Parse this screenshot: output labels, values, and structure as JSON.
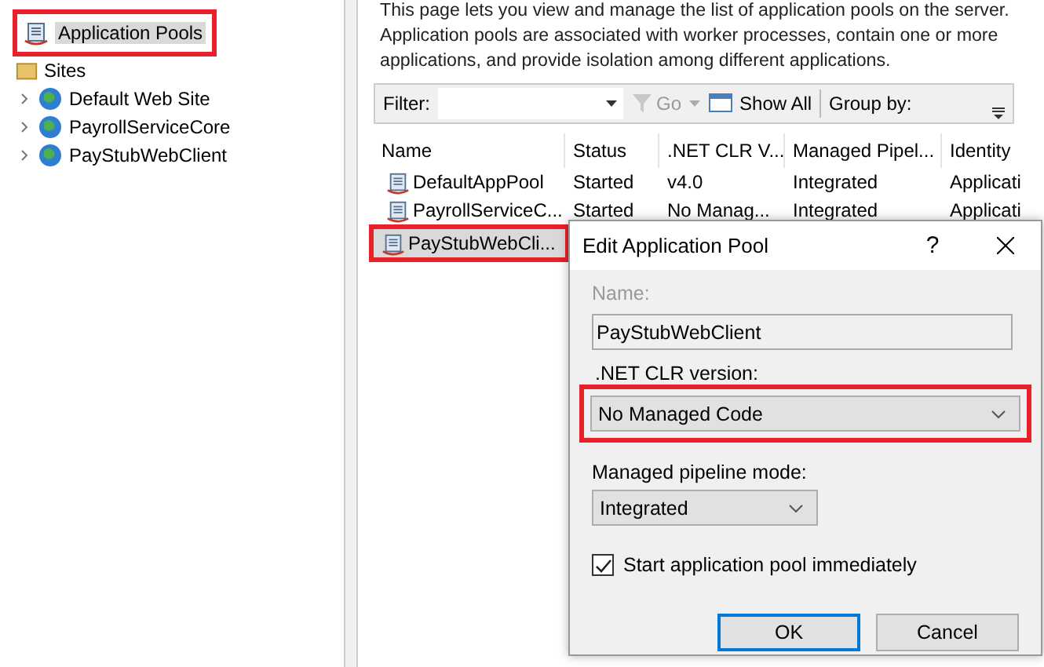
{
  "tree": {
    "pools": {
      "label": "Application Pools",
      "selected": true,
      "highlighted": true
    },
    "sites": {
      "label": "Sites",
      "children": [
        {
          "label": "Default Web Site",
          "expanded": false
        },
        {
          "label": "PayrollServiceCore",
          "expanded": false
        },
        {
          "label": "PayStubWebClient",
          "expanded": false
        }
      ]
    }
  },
  "description": "This page lets you view and manage the list of application pools on the server. Application pools are associated with worker processes, contain one or more applications, and provide isolation among different applications.",
  "toolbar": {
    "filter_label": "Filter:",
    "go": {
      "label": "Go",
      "disabled": true
    },
    "show_all": "Show All",
    "group_by": "Group by:"
  },
  "table": {
    "columns": [
      "Name",
      "Status",
      ".NET CLR V...",
      "Managed Pipel...",
      "Identity"
    ],
    "rows": [
      {
        "cells": [
          "DefaultAppPool",
          "Started",
          "v4.0",
          "Integrated",
          "Applicati"
        ],
        "selected": false,
        "highlighted": false
      },
      {
        "cells": [
          "PayrollServiceC...",
          "Started",
          "No Manag...",
          "Integrated",
          "Applicati"
        ],
        "selected": false,
        "highlighted": false
      },
      {
        "cells": [
          "PayStubWebCli..."
        ],
        "selected": true,
        "highlighted": true
      }
    ]
  },
  "dialog": {
    "title": "Edit Application Pool",
    "help": "?",
    "name_label": "Name:",
    "name_disabled": true,
    "name_value": "PayStubWebClient",
    "clr_label": ".NET CLR version:",
    "clr_value": "No Managed Code",
    "clr_highlighted": true,
    "pipeline_label": "Managed pipeline mode:",
    "pipeline_value": "Integrated",
    "start_label": "Start application pool immediately",
    "start_checked": true,
    "ok": "OK",
    "cancel": "Cancel"
  }
}
